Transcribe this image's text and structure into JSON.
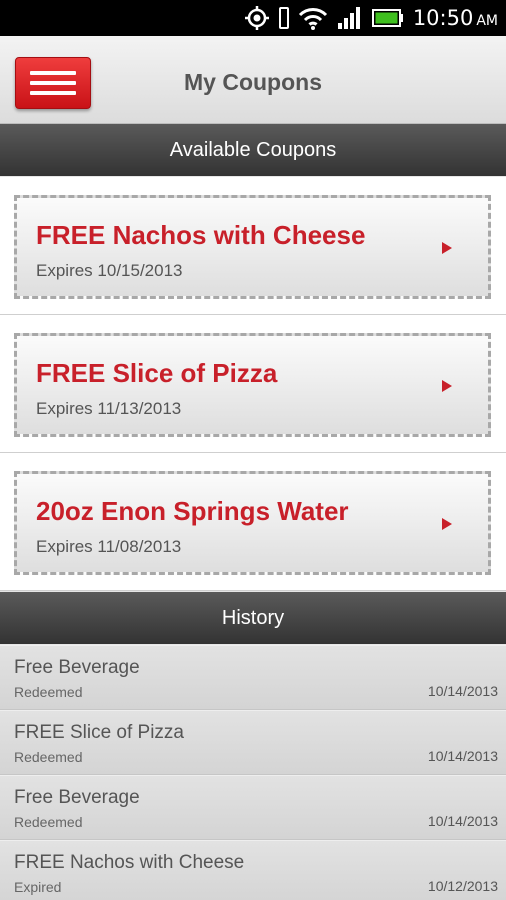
{
  "status_bar": {
    "time": "10:50",
    "ampm": "AM"
  },
  "header": {
    "title": "My Coupons"
  },
  "available": {
    "heading": "Available Coupons",
    "coupons": [
      {
        "title": "FREE Nachos with Cheese",
        "expires": "Expires 10/15/2013"
      },
      {
        "title": "FREE Slice of Pizza",
        "expires": "Expires 11/13/2013"
      },
      {
        "title": "20oz Enon Springs Water",
        "expires": "Expires 11/08/2013"
      }
    ]
  },
  "history": {
    "heading": "History",
    "items": [
      {
        "name": "Free Beverage",
        "status": "Redeemed",
        "date": "10/14/2013"
      },
      {
        "name": "FREE Slice of Pizza",
        "status": "Redeemed",
        "date": "10/14/2013"
      },
      {
        "name": "Free Beverage",
        "status": "Redeemed",
        "date": "10/14/2013"
      },
      {
        "name": "FREE Nachos with Cheese",
        "status": "Expired",
        "date": "10/12/2013"
      }
    ]
  },
  "colors": {
    "accent": "#c8202a",
    "header_dark": "#3d3d3d"
  }
}
